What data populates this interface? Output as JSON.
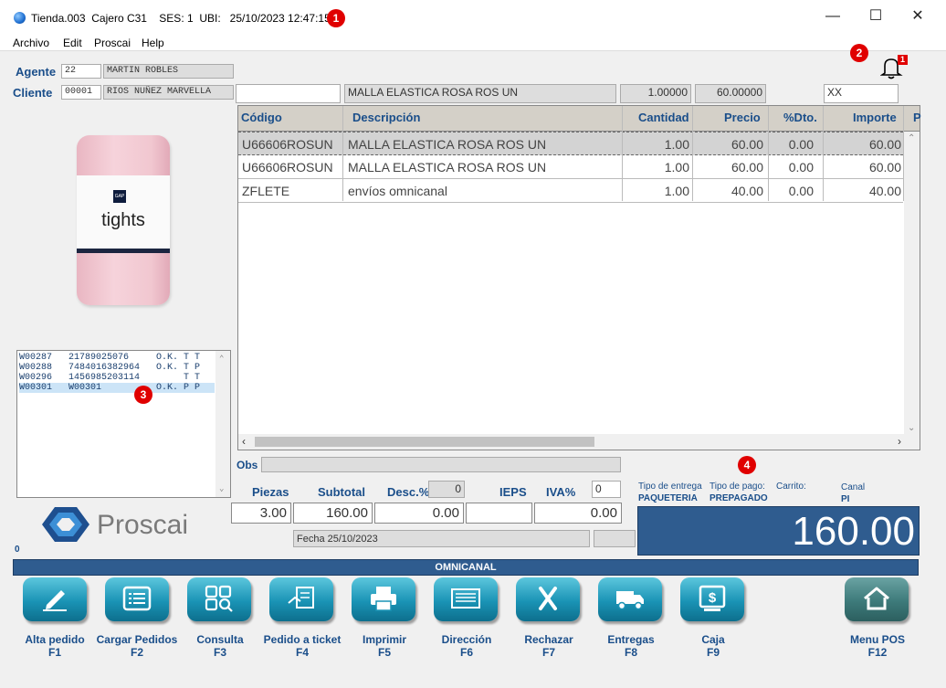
{
  "window": {
    "title": "Tienda.003  Cajero C31    SES: 1  UBI:   25/10/2023 12:47:15",
    "min": "—",
    "max": "☐",
    "close": "✕"
  },
  "badges": {
    "b1": "1",
    "b2": "2",
    "b3": "3",
    "b4": "4"
  },
  "menu": [
    "Archivo",
    "Edit",
    "Proscai",
    "Help"
  ],
  "agente": {
    "label": "Agente",
    "code": "22",
    "name": "MARTIN ROBLES"
  },
  "cliente": {
    "label": "Cliente",
    "code": "00001",
    "name": "RIOS NUÑEZ MARVELLA"
  },
  "notification": {
    "count": "1"
  },
  "entry": {
    "code": "",
    "description": "MALLA ELASTICA ROSA ROS UN",
    "qty": "1.00000",
    "price": "60.00000",
    "extra": "XX"
  },
  "product_image": {
    "brand": "GAP",
    "text": "tights"
  },
  "grid": {
    "headers": [
      "Código",
      "Descripción",
      "Cantidad",
      "Precio",
      "%Dto.",
      "Importe",
      "P"
    ],
    "rows": [
      {
        "codigo": "U66606ROSUN",
        "desc": "MALLA ELASTICA ROSA ROS UN",
        "cantidad": "1.00",
        "precio": "60.00",
        "dto": "0.00",
        "importe": "60.00"
      },
      {
        "codigo": "U66606ROSUN",
        "desc": "MALLA ELASTICA ROSA ROS UN",
        "cantidad": "1.00",
        "precio": "60.00",
        "dto": "0.00",
        "importe": "60.00"
      },
      {
        "codigo": "ZFLETE",
        "desc": "envíos omnicanal",
        "cantidad": "1.00",
        "precio": "40.00",
        "dto": "0.00",
        "importe": "40.00"
      }
    ]
  },
  "orders": [
    "W00287   21789025076     O.K. T T",
    "W00288   7484016382964   O.K. T P",
    "W00296   1456985203114        T T",
    "W00301   W00301          O.K. P P"
  ],
  "obs": {
    "label": "Obs",
    "value": ""
  },
  "totals": {
    "piezas_label": "Piezas",
    "piezas": "3.00",
    "subtotal_label": "Subtotal",
    "subtotal": "160.00",
    "desc_label": "Desc.%",
    "desc_pct": "0",
    "desc": "0.00",
    "ieps_label": "IEPS",
    "ieps": "",
    "iva_label": "IVA%",
    "iva_pct": "0",
    "iva": "0.00",
    "fecha": "Fecha 25/10/2023",
    "total": "160.00"
  },
  "delivery": {
    "tipo_entrega_label": "Tipo de entrega",
    "tipo_entrega": "PAQUETERIA",
    "tipo_pago_label": "Tipo de pago:",
    "tipo_pago": "PREPAGADO",
    "carrito_label": "Carrito:",
    "carrito": "",
    "canal_label": "Canal",
    "canal": "PI"
  },
  "logo": {
    "text": "Proscai",
    "counter": "0"
  },
  "omnibar": "OMNICANAL",
  "fkeys": [
    {
      "label": "Alta pedido",
      "key": "F1",
      "icon": "pencil-icon"
    },
    {
      "label": "Cargar Pedidos",
      "key": "F2",
      "icon": "list-icon"
    },
    {
      "label": "Consulta",
      "key": "F3",
      "icon": "search-grid-icon"
    },
    {
      "label": "Pedido a ticket",
      "key": "F4",
      "icon": "ticket-icon"
    },
    {
      "label": "Imprimir",
      "key": "F5",
      "icon": "printer-icon"
    },
    {
      "label": "Dirección",
      "key": "F6",
      "icon": "address-icon"
    },
    {
      "label": "Rechazar",
      "key": "F7",
      "icon": "reject-icon"
    },
    {
      "label": "Entregas",
      "key": "F8",
      "icon": "truck-icon"
    },
    {
      "label": "Caja",
      "key": "F9",
      "icon": "cash-icon"
    },
    {
      "label": "Menu POS",
      "key": "F12",
      "icon": "home-icon"
    }
  ],
  "colors": {
    "accent": "#2f5c8f",
    "label": "#1a4e8a",
    "button": "#1a93b5",
    "badge": "#e00000"
  }
}
